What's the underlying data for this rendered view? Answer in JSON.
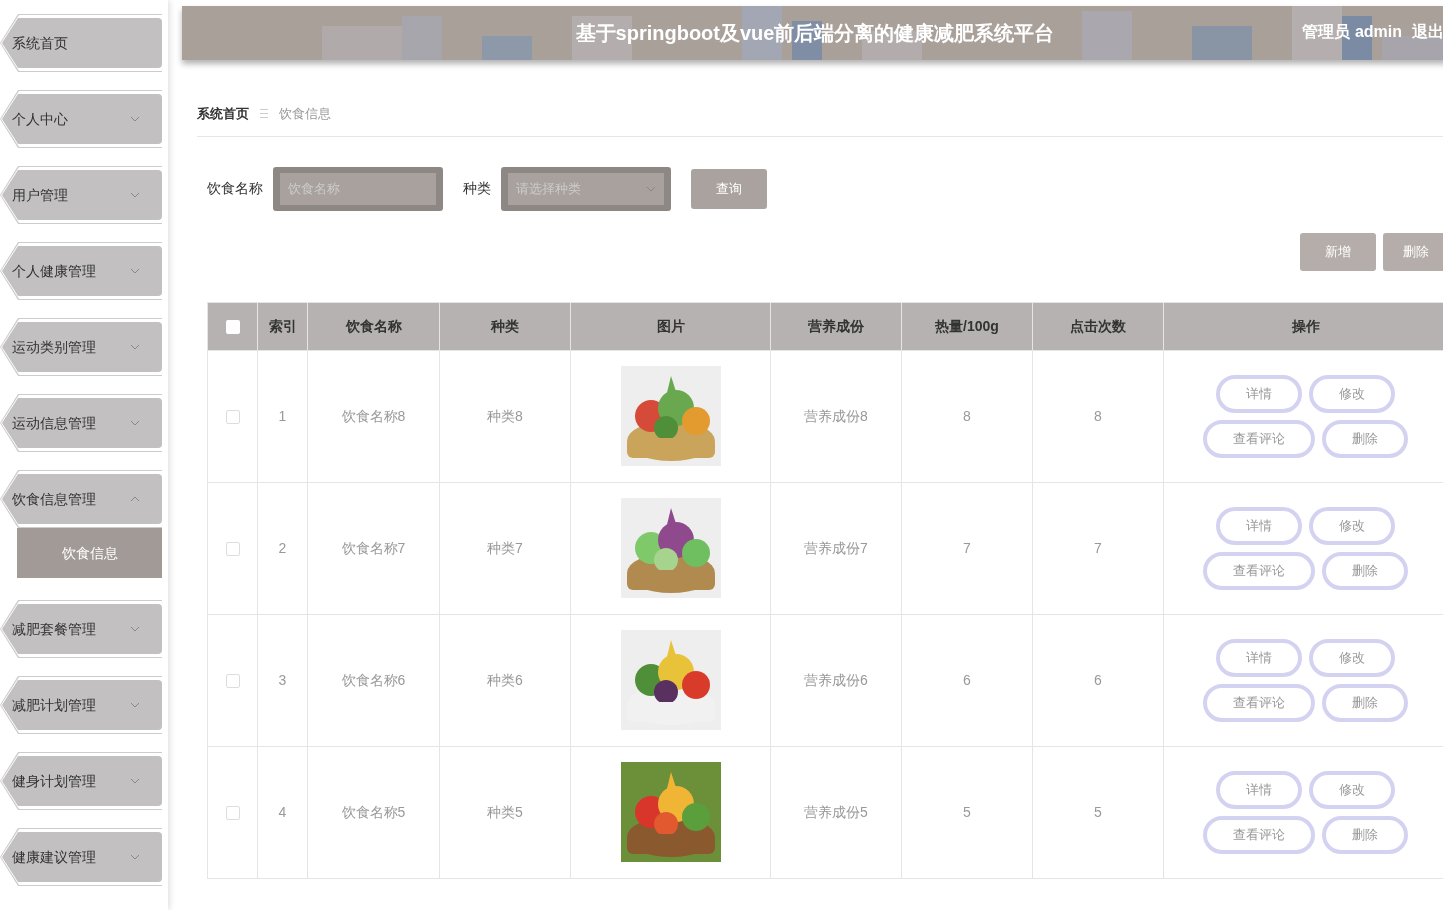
{
  "sidebar": {
    "items": [
      {
        "label": "系统首页"
      },
      {
        "label": "个人中心",
        "expanded": false
      },
      {
        "label": "用户管理",
        "expanded": false
      },
      {
        "label": "个人健康管理",
        "expanded": false
      },
      {
        "label": "运动类别管理",
        "expanded": false
      },
      {
        "label": "运动信息管理",
        "expanded": false
      },
      {
        "label": "饮食信息管理",
        "expanded": true,
        "children": [
          {
            "label": "饮食信息",
            "selected": true
          }
        ]
      },
      {
        "label": "减肥套餐管理",
        "expanded": false
      },
      {
        "label": "减肥计划管理",
        "expanded": false
      },
      {
        "label": "健身计划管理",
        "expanded": false
      },
      {
        "label": "健康建议管理",
        "expanded": false
      }
    ]
  },
  "header": {
    "title": "基于springboot及vue前后端分离的健康减肥系统平台",
    "user": "管理员 admin",
    "logout": "退出"
  },
  "breadcrumb": [
    "系统首页",
    "饮食信息"
  ],
  "search": {
    "fields": [
      {
        "label": "饮食名称",
        "kind": "input",
        "placeholder": "饮食名称"
      },
      {
        "label": "种类",
        "kind": "select",
        "placeholder": "请选择种类"
      }
    ],
    "button": "查询"
  },
  "toolbar": [
    "新增",
    "删除"
  ],
  "table": {
    "header_checked": false,
    "columns": [
      "索引",
      "饮食名称",
      "种类",
      "图片",
      "营养成份",
      "热量/100g",
      "点击次数",
      "操作"
    ],
    "rows": [
      {
        "checked": false,
        "index": "1",
        "name": "饮食名称8",
        "type": "种类8",
        "nutrition": "营养成份8",
        "calories": "8",
        "clicks": "8",
        "actions": [
          [
            "详情",
            "修改"
          ],
          [
            "查看评论",
            "删除"
          ]
        ]
      },
      {
        "checked": false,
        "index": "2",
        "name": "饮食名称7",
        "type": "种类7",
        "nutrition": "营养成份7",
        "calories": "7",
        "clicks": "7",
        "actions": [
          [
            "详情",
            "修改"
          ],
          [
            "查看评论",
            "删除"
          ]
        ]
      },
      {
        "checked": false,
        "index": "3",
        "name": "饮食名称6",
        "type": "种类6",
        "nutrition": "营养成份6",
        "calories": "6",
        "clicks": "6",
        "actions": [
          [
            "详情",
            "修改"
          ],
          [
            "查看评论",
            "删除"
          ]
        ]
      },
      {
        "checked": false,
        "index": "4",
        "name": "饮食名称5",
        "type": "种类5",
        "nutrition": "营养成份5",
        "calories": "5",
        "clicks": "5",
        "actions": [
          [
            "详情",
            "修改"
          ],
          [
            "查看评论",
            "删除"
          ]
        ]
      }
    ]
  }
}
